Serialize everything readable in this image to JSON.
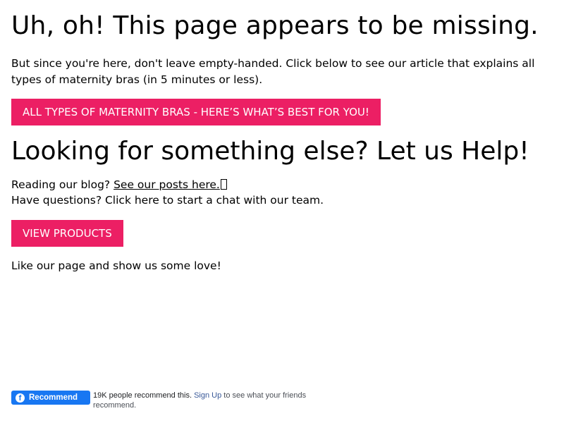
{
  "heading": "Uh, oh! This page appears to be missing.",
  "intro_text": "But since you're here, don't leave empty-handed. Click below to see our article that explains all types of maternity bras (in 5 minutes or less).",
  "article_button_label": "ALL TYPES OF MATERNITY BRAS - HERE’S WHAT’S BEST FOR YOU!",
  "help_heading": "Looking for something else? Let us Help!",
  "blog_line": {
    "prefix": "Reading our blog? ",
    "link_text": "See our posts here.",
    "link_icon": "external-link-icon"
  },
  "questions_line": "Have questions? Click here to start a chat with our team.",
  "products_button_label": "VIEW PRODUCTS",
  "love_text": "Like our page and show us some love!",
  "facebook_widget": {
    "button_label": "Recommend",
    "count_text": "19K people recommend this.",
    "signup_link": "Sign Up",
    "suffix_text": "to see what your friends recommend."
  },
  "colors": {
    "accent_pink": "#ec1f64",
    "facebook_blue": "#1877f2"
  }
}
